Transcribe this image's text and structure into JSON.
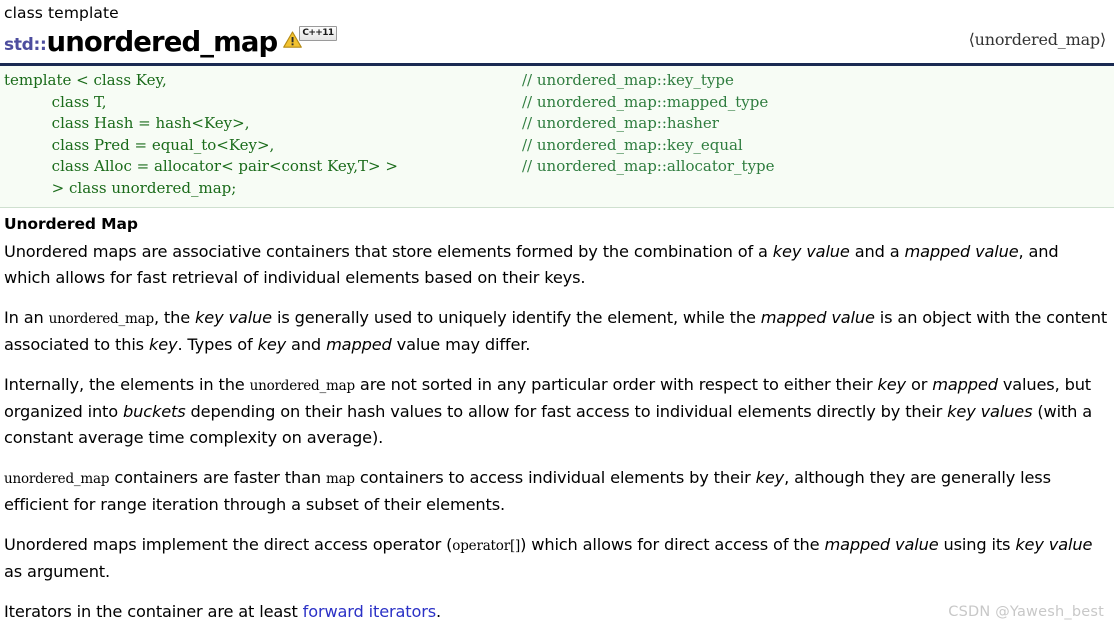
{
  "header": {
    "kicker": "class template",
    "namespace": "std::",
    "name": "unordered_map",
    "warning_icon": "warning-triangle-icon",
    "standard_badge": "C++11",
    "include_header": "⟨unordered_map⟩"
  },
  "code_block": {
    "lines": [
      {
        "code": "template < class Key,",
        "comment": "// unordered_map::key_type"
      },
      {
        "code": "          class T,",
        "comment": "// unordered_map::mapped_type"
      },
      {
        "code": "          class Hash = hash<Key>,",
        "comment": "// unordered_map::hasher"
      },
      {
        "code": "          class Pred = equal_to<Key>,",
        "comment": "// unordered_map::key_equal"
      },
      {
        "code": "          class Alloc = allocator< pair<const Key,T> >",
        "comment": "// unordered_map::allocator_type"
      },
      {
        "code": "          > class unordered_map;",
        "comment": ""
      }
    ]
  },
  "section": {
    "heading": "Unordered Map",
    "paragraphs": [
      {
        "id": "p1",
        "parts": [
          {
            "t": "text",
            "v": "Unordered maps are associative containers that store elements formed by the combination of a "
          },
          {
            "t": "em",
            "v": "key value"
          },
          {
            "t": "text",
            "v": " and a "
          },
          {
            "t": "em",
            "v": "mapped value"
          },
          {
            "t": "text",
            "v": ", and which allows for fast retrieval of individual elements based on their keys."
          }
        ]
      },
      {
        "id": "p2",
        "parts": [
          {
            "t": "text",
            "v": "In an "
          },
          {
            "t": "code",
            "v": "unordered_map"
          },
          {
            "t": "text",
            "v": ", the "
          },
          {
            "t": "em",
            "v": "key value"
          },
          {
            "t": "text",
            "v": " is generally used to uniquely identify the element, while the "
          },
          {
            "t": "em",
            "v": "mapped value"
          },
          {
            "t": "text",
            "v": " is an object with the content associated to this "
          },
          {
            "t": "em",
            "v": "key"
          },
          {
            "t": "text",
            "v": ". Types of "
          },
          {
            "t": "em",
            "v": "key"
          },
          {
            "t": "text",
            "v": " and "
          },
          {
            "t": "em",
            "v": "mapped"
          },
          {
            "t": "text",
            "v": " value may differ."
          }
        ]
      },
      {
        "id": "p3",
        "parts": [
          {
            "t": "text",
            "v": "Internally, the elements in the "
          },
          {
            "t": "code",
            "v": "unordered_map"
          },
          {
            "t": "text",
            "v": " are not sorted in any particular order with respect to either their "
          },
          {
            "t": "em",
            "v": "key"
          },
          {
            "t": "text",
            "v": " or "
          },
          {
            "t": "em",
            "v": "mapped"
          },
          {
            "t": "text",
            "v": " values, but organized into "
          },
          {
            "t": "em",
            "v": "buckets"
          },
          {
            "t": "text",
            "v": " depending on their hash values to allow for fast access to individual elements directly by their "
          },
          {
            "t": "em",
            "v": "key values"
          },
          {
            "t": "text",
            "v": " (with a constant average time complexity on average)."
          }
        ]
      },
      {
        "id": "p4",
        "parts": [
          {
            "t": "code",
            "v": "unordered_map"
          },
          {
            "t": "text",
            "v": " containers are faster than "
          },
          {
            "t": "code",
            "v": "map"
          },
          {
            "t": "text",
            "v": " containers to access individual elements by their "
          },
          {
            "t": "em",
            "v": "key"
          },
          {
            "t": "text",
            "v": ", although they are generally less efficient for range iteration through a subset of their elements."
          }
        ]
      },
      {
        "id": "p5",
        "parts": [
          {
            "t": "text",
            "v": "Unordered maps implement the direct access operator ("
          },
          {
            "t": "code",
            "v": "operator[]"
          },
          {
            "t": "text",
            "v": ") which allows for direct access of the "
          },
          {
            "t": "em",
            "v": "mapped value"
          },
          {
            "t": "text",
            "v": " using its "
          },
          {
            "t": "em",
            "v": "key value"
          },
          {
            "t": "text",
            "v": " as argument."
          }
        ]
      },
      {
        "id": "p6",
        "parts": [
          {
            "t": "text",
            "v": "Iterators in the container are at least "
          },
          {
            "t": "link",
            "v": "forward iterators"
          },
          {
            "t": "text",
            "v": "."
          }
        ]
      }
    ]
  },
  "watermark": "CSDN @Yawesh_best",
  "colors": {
    "code_bg": "#f7fcf5",
    "code_top_border": "#1a2a52",
    "code_text": "#1a6b1a",
    "comment_text": "#2f7d3f",
    "namespace_color": "#4d4d9e",
    "link_color": "#2b31c6",
    "watermark_color": "#c8c8c8"
  }
}
